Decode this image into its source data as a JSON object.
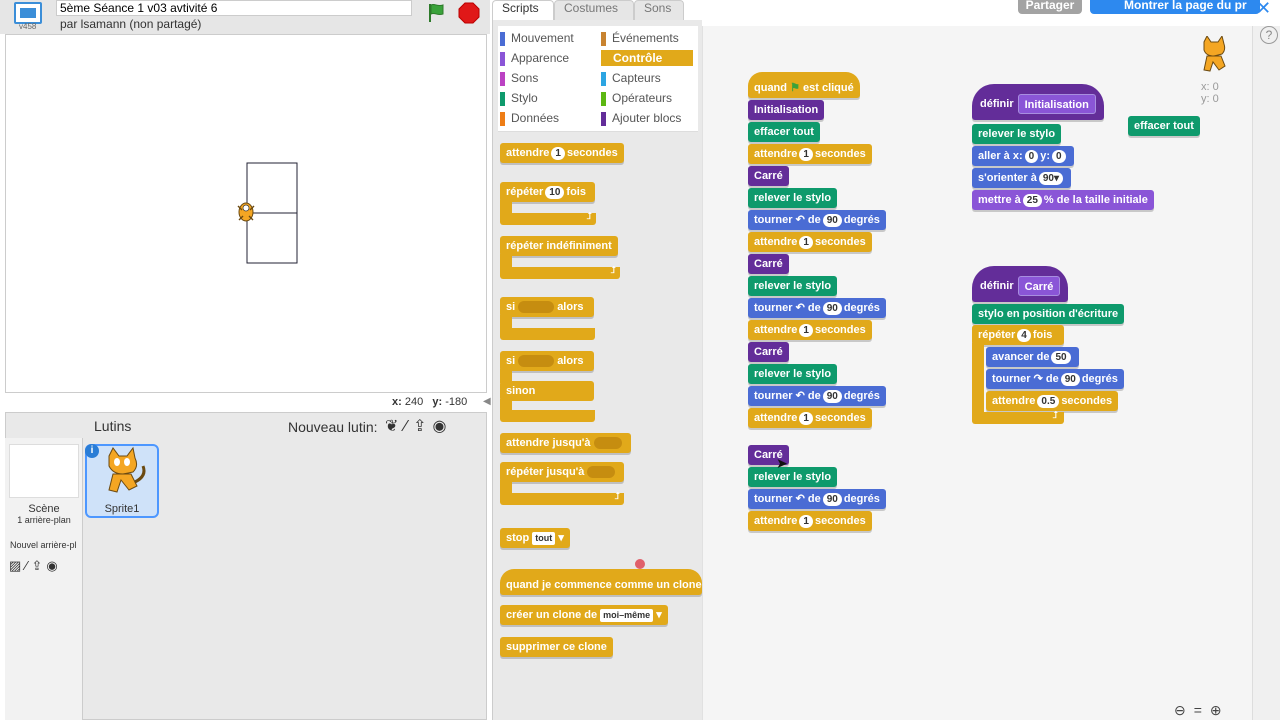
{
  "project": {
    "title": "5ème Séance 1 v03 avtivité 6",
    "author": "par lsamann (non partagé)",
    "version": "v458"
  },
  "stage": {
    "coords_x_label": "x:",
    "coords_x": "240",
    "coords_y_label": "y:",
    "coords_y": "-180"
  },
  "sprites": {
    "header": "Lutins",
    "new_label": "Nouveau lutin:",
    "scene_label": "Scène",
    "scene_sub": "1 arrière-plan",
    "new_bg": "Nouvel arrière-pl",
    "sprite1": "Sprite1"
  },
  "tabs": [
    "Scripts",
    "Costumes",
    "Sons"
  ],
  "top_right": {
    "share": "Partager",
    "see_project": "Montrer la page du pr",
    "help": "?"
  },
  "categories": [
    {
      "label": "Mouvement",
      "color": "#4a6cd4"
    },
    {
      "label": "Événements",
      "color": "#c88330"
    },
    {
      "label": "Apparence",
      "color": "#8a55d7"
    },
    {
      "label": "Contrôle",
      "color": "#e1a91a"
    },
    {
      "label": "Sons",
      "color": "#bb42c3"
    },
    {
      "label": "Capteurs",
      "color": "#2ca5e2"
    },
    {
      "label": "Stylo",
      "color": "#0e9a6c"
    },
    {
      "label": "Opérateurs",
      "color": "#5cb712"
    },
    {
      "label": "Données",
      "color": "#ee7d16"
    },
    {
      "label": "Ajouter blocs",
      "color": "#632d99"
    }
  ],
  "palette": {
    "wait": "attendre",
    "wait_val": "1",
    "seconds": "secondes",
    "repeat": "répéter",
    "repeat_val": "10",
    "times": "fois",
    "forever": "répéter indéfiniment",
    "if": "si",
    "then": "alors",
    "else": "sinon",
    "wait_until": "attendre jusqu'à",
    "repeat_until": "répéter jusqu'à",
    "stop": "stop",
    "stop_val": "tout",
    "clone_start": "quand je commence comme un clone",
    "create_clone": "créer un clone de",
    "create_clone_val": "moi–même",
    "delete_clone": "supprimer ce clone"
  },
  "script": {
    "when_flag_pre": "quand",
    "when_flag_post": "est cliqué",
    "init": "Initialisation",
    "clear": "effacer tout",
    "wait": "attendre",
    "sec": "secondes",
    "one": "1",
    "square": "Carré",
    "pen_up": "relever le stylo",
    "turn": "tourner",
    "of": "de",
    "ninety": "90",
    "degrees": "degrés"
  },
  "defs": {
    "define": "définir",
    "init_name": "Initialisation",
    "pen_up": "relever le stylo",
    "goto": "aller à x:",
    "goto_x": "0",
    "y_label": "y:",
    "goto_y": "0",
    "point": "s'orienter à",
    "point_val": "90▾",
    "size": "mettre à",
    "size_val": "25",
    "size_post": "% de la taille initiale",
    "clear": "effacer tout",
    "square_name": "Carré",
    "pen_down": "stylo en position d'écriture",
    "repeat": "répéter",
    "repeat_val": "4",
    "times": "fois",
    "move": "avancer de",
    "move_val": "50",
    "turn": "tourner",
    "of": "de",
    "turn_val": "90",
    "degrees": "degrés",
    "wait": "attendre",
    "wait_val": "0.5",
    "sec": "secondes"
  },
  "corner": {
    "x": "x: 0",
    "y": "y: 0"
  }
}
